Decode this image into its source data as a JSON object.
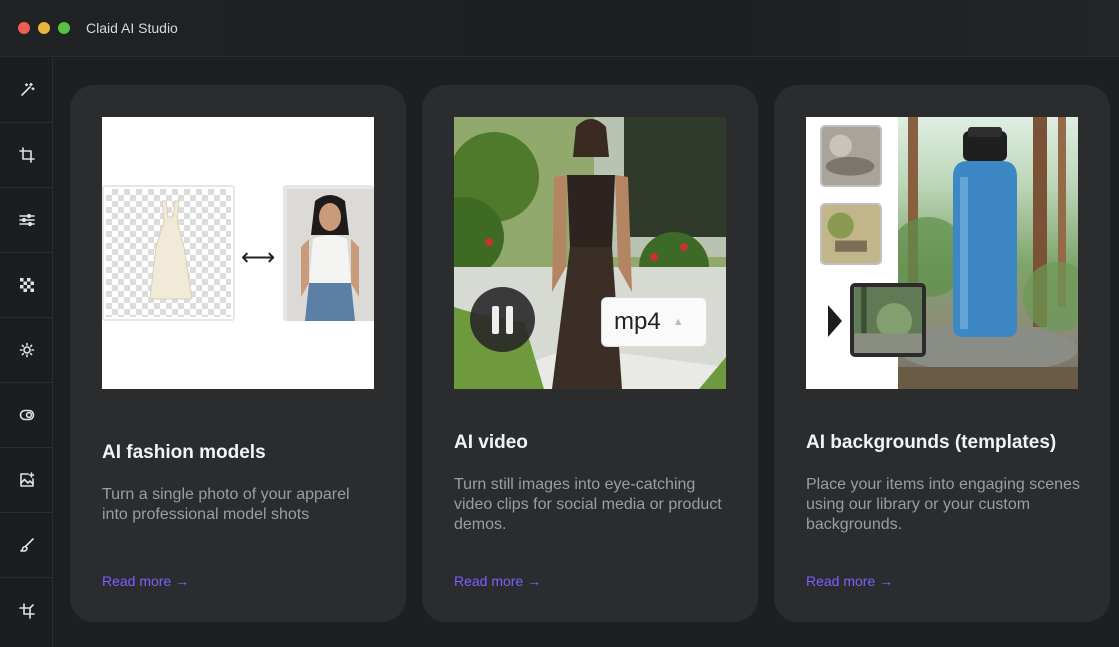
{
  "window": {
    "title": "Claid AI Studio"
  },
  "sidebar": {
    "items": [
      {
        "icon": "magic-wand-icon"
      },
      {
        "icon": "crop-icon"
      },
      {
        "icon": "sliders-icon"
      },
      {
        "icon": "checkerboard-icon"
      },
      {
        "icon": "sun-icon"
      },
      {
        "icon": "toggle-icon"
      },
      {
        "icon": "image-add-icon"
      },
      {
        "icon": "brush-icon"
      },
      {
        "icon": "crop-alt-icon"
      }
    ]
  },
  "cards": [
    {
      "title": "AI fashion models",
      "description": "Turn a single photo of your apparel into professional model shots",
      "link": "Read more →"
    },
    {
      "title": "AI video",
      "description": "Turn still images into eye-catching video clips for social media or product demos.",
      "link": "Read more →",
      "format": "mp4"
    },
    {
      "title": "AI backgrounds (templates)",
      "description": "Place your items into engaging scenes using our library or your custom backgrounds.",
      "link": "Read more →"
    }
  ],
  "colors": {
    "accent": "#7b61ff",
    "card": "#2a2c2e",
    "background": "#1d1f21"
  }
}
